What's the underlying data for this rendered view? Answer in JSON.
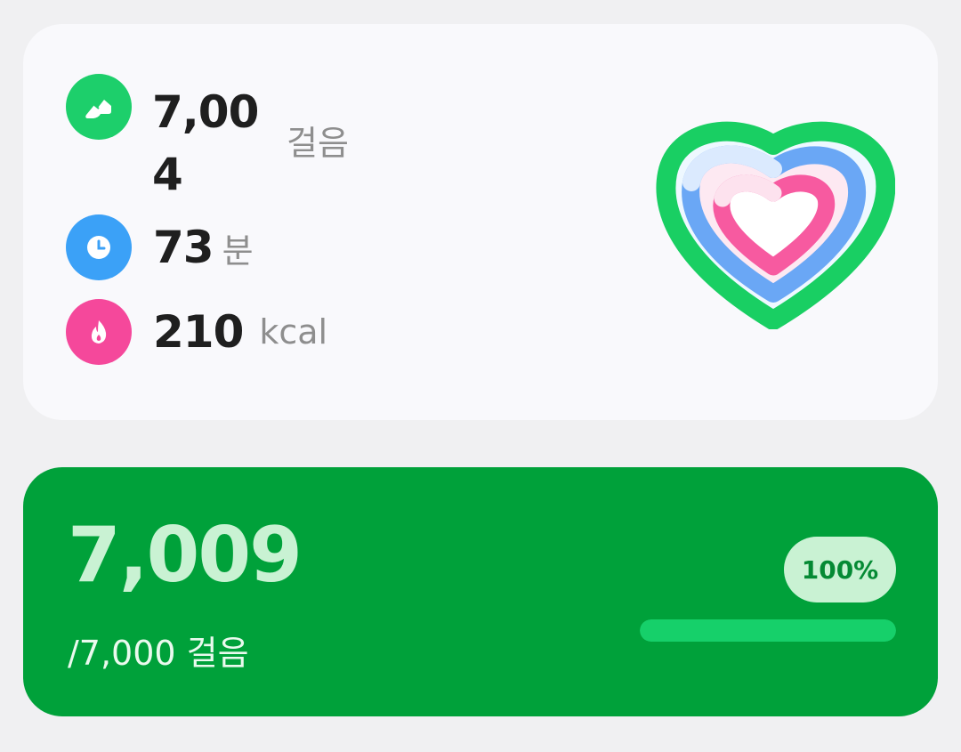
{
  "summary": {
    "steps": {
      "value": "7,004",
      "unit": "걸음",
      "icon": "shoe-icon",
      "color": "#1dcf6b"
    },
    "time": {
      "value": "73",
      "unit": "분",
      "icon": "clock-icon",
      "color": "#3ba1f7"
    },
    "calories": {
      "value": "210",
      "unit": "kcal",
      "icon": "flame-icon",
      "color": "#f5489b"
    }
  },
  "goal": {
    "count": "7,009",
    "target": "/7,000 걸음",
    "percent": "100%",
    "progress": 1.0,
    "background_color": "#00a13a"
  }
}
